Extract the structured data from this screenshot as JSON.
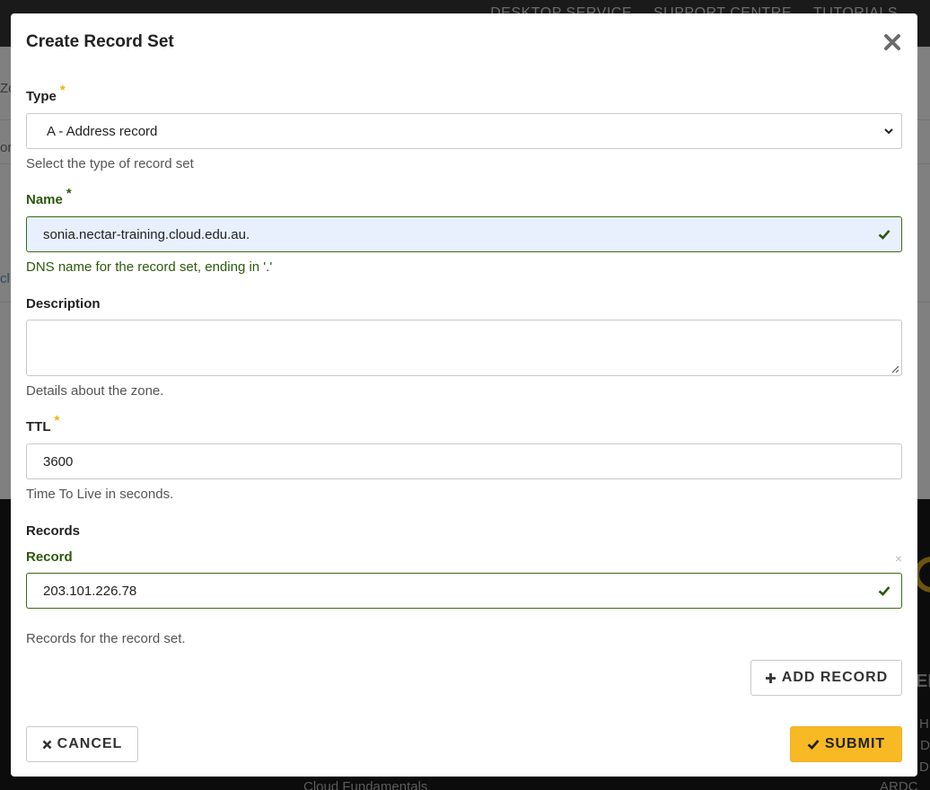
{
  "background": {
    "nav_items": [
      "DESKTOP SERVICE",
      "SUPPORT CENTRE",
      "TUTORIALS"
    ],
    "footer_text": "Cloud Fundamentals",
    "right_edge_1": "ER",
    "right_edge_2": "H",
    "right_edge_3": "r D",
    "right_edge_4": "D",
    "right_edge_5": "ARDC O",
    "left_edge_1": "Zo",
    "left_edge_2": "or",
    "left_edge_3": "cl"
  },
  "modal": {
    "title": "Create Record Set",
    "close_icon": "close-icon",
    "type": {
      "label": "Type",
      "required_mark": "*",
      "value": "A - Address record",
      "help": "Select the type of record set"
    },
    "name": {
      "label": "Name",
      "required_mark": "*",
      "value": "sonia.nectar-training.cloud.edu.au.",
      "help": "DNS name for the record set, ending in '.'"
    },
    "description": {
      "label": "Description",
      "value": "",
      "help": "Details about the zone."
    },
    "ttl": {
      "label": "TTL",
      "required_mark": "*",
      "value": "3600",
      "help": "Time To Live in seconds."
    },
    "records": {
      "label": "Records",
      "record_label": "Record",
      "remove_glyph": "×",
      "value": "203.101.226.78",
      "help": "Records for the record set.",
      "add_label": "ADD RECORD"
    },
    "cancel_label": "CANCEL",
    "submit_label": "SUBMIT"
  },
  "colors": {
    "accent": "#f7b924",
    "success": "#2b5a0a",
    "required": "#f0b400"
  }
}
